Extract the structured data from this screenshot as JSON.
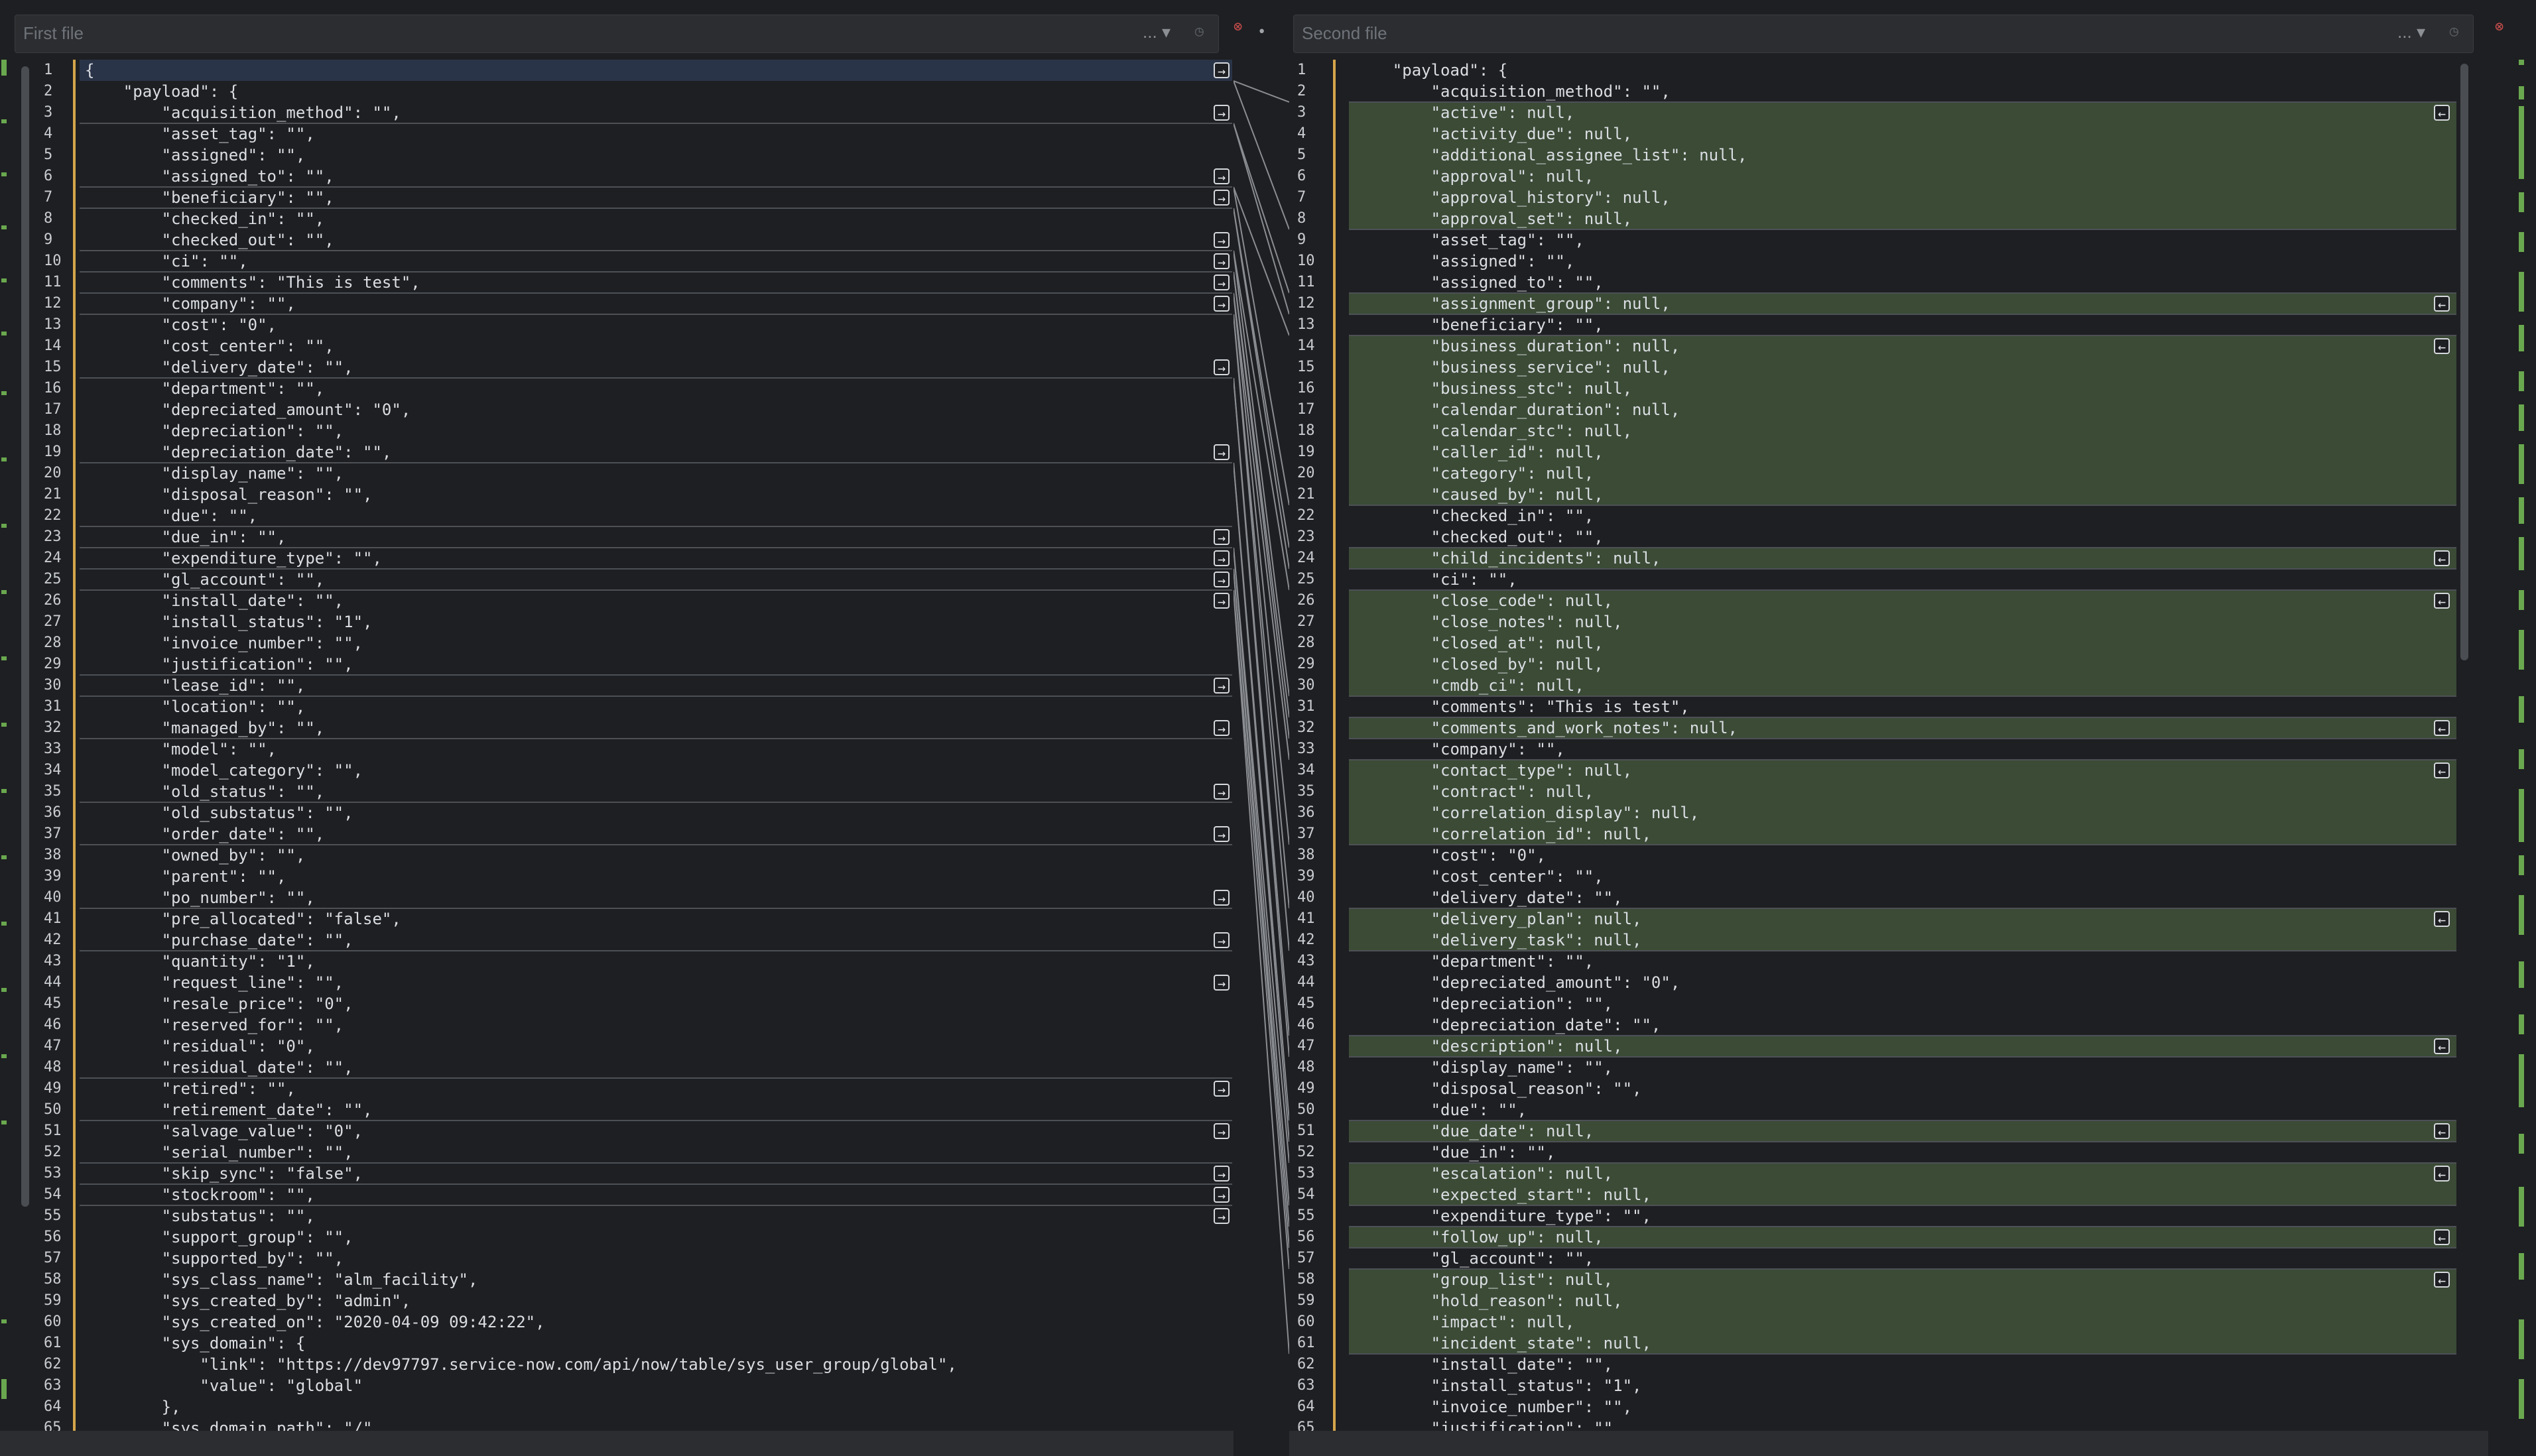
{
  "left": {
    "title": "First file",
    "menu": "...",
    "lines": [
      "{",
      "    \"payload\": {",
      "        \"acquisition_method\": \"\",",
      "        \"asset_tag\": \"\",",
      "        \"assigned\": \"\",",
      "        \"assigned_to\": \"\",",
      "        \"beneficiary\": \"\",",
      "        \"checked_in\": \"\",",
      "        \"checked_out\": \"\",",
      "        \"ci\": \"\",",
      "        \"comments\": \"This is test\",",
      "        \"company\": \"\",",
      "        \"cost\": \"0\",",
      "        \"cost_center\": \"\",",
      "        \"delivery_date\": \"\",",
      "        \"department\": \"\",",
      "        \"depreciated_amount\": \"0\",",
      "        \"depreciation\": \"\",",
      "        \"depreciation_date\": \"\",",
      "        \"display_name\": \"\",",
      "        \"disposal_reason\": \"\",",
      "        \"due\": \"\",",
      "        \"due_in\": \"\",",
      "        \"expenditure_type\": \"\",",
      "        \"gl_account\": \"\",",
      "        \"install_date\": \"\",",
      "        \"install_status\": \"1\",",
      "        \"invoice_number\": \"\",",
      "        \"justification\": \"\",",
      "        \"lease_id\": \"\",",
      "        \"location\": \"\",",
      "        \"managed_by\": \"\",",
      "        \"model\": \"\",",
      "        \"model_category\": \"\",",
      "        \"old_status\": \"\",",
      "        \"old_substatus\": \"\",",
      "        \"order_date\": \"\",",
      "        \"owned_by\": \"\",",
      "        \"parent\": \"\",",
      "        \"po_number\": \"\",",
      "        \"pre_allocated\": \"false\",",
      "        \"purchase_date\": \"\",",
      "        \"quantity\": \"1\",",
      "        \"request_line\": \"\",",
      "        \"resale_price\": \"0\",",
      "        \"reserved_for\": \"\",",
      "        \"residual\": \"0\",",
      "        \"residual_date\": \"\",",
      "        \"retired\": \"\",",
      "        \"retirement_date\": \"\",",
      "        \"salvage_value\": \"0\",",
      "        \"serial_number\": \"\",",
      "        \"skip_sync\": \"false\",",
      "        \"stockroom\": \"\",",
      "        \"substatus\": \"\",",
      "        \"support_group\": \"\",",
      "        \"supported_by\": \"\",",
      "        \"sys_class_name\": \"alm_facility\",",
      "        \"sys_created_by\": \"admin\",",
      "        \"sys_created_on\": \"2020-04-09 09:42:22\",",
      "        \"sys_domain\": {",
      "            \"link\": \"https://dev97797.service-now.com/api/now/table/sys_user_group/global\",",
      "            \"value\": \"global\"",
      "        },",
      "        \"sys_domain_path\": \"/\","
    ]
  },
  "right": {
    "title": "Second file",
    "menu": "...",
    "lines": [
      "    \"payload\": {",
      "        \"acquisition_method\": \"\",",
      "        \"active\": null,",
      "        \"activity_due\": null,",
      "        \"additional_assignee_list\": null,",
      "        \"approval\": null,",
      "        \"approval_history\": null,",
      "        \"approval_set\": null,",
      "        \"asset_tag\": \"\",",
      "        \"assigned\": \"\",",
      "        \"assigned_to\": \"\",",
      "        \"assignment_group\": null,",
      "        \"beneficiary\": \"\",",
      "        \"business_duration\": null,",
      "        \"business_service\": null,",
      "        \"business_stc\": null,",
      "        \"calendar_duration\": null,",
      "        \"calendar_stc\": null,",
      "        \"caller_id\": null,",
      "        \"category\": null,",
      "        \"caused_by\": null,",
      "        \"checked_in\": \"\",",
      "        \"checked_out\": \"\",",
      "        \"child_incidents\": null,",
      "        \"ci\": \"\",",
      "        \"close_code\": null,",
      "        \"close_notes\": null,",
      "        \"closed_at\": null,",
      "        \"closed_by\": null,",
      "        \"cmdb_ci\": null,",
      "        \"comments\": \"This is test\",",
      "        \"comments_and_work_notes\": null,",
      "        \"company\": \"\",",
      "        \"contact_type\": null,",
      "        \"contract\": null,",
      "        \"correlation_display\": null,",
      "        \"correlation_id\": null,",
      "        \"cost\": \"0\",",
      "        \"cost_center\": \"\",",
      "        \"delivery_date\": \"\",",
      "        \"delivery_plan\": null,",
      "        \"delivery_task\": null,",
      "        \"department\": \"\",",
      "        \"depreciated_amount\": \"0\",",
      "        \"depreciation\": \"\",",
      "        \"depreciation_date\": \"\",",
      "        \"description\": null,",
      "        \"display_name\": \"\",",
      "        \"disposal_reason\": \"\",",
      "        \"due\": \"\",",
      "        \"due_date\": null,",
      "        \"due_in\": \"\",",
      "        \"escalation\": null,",
      "        \"expected_start\": null,",
      "        \"expenditure_type\": \"\",",
      "        \"follow_up\": null,",
      "        \"gl_account\": \"\",",
      "        \"group_list\": null,",
      "        \"hold_reason\": null,",
      "        \"impact\": null,",
      "        \"incident_state\": null,",
      "        \"install_date\": \"\",",
      "        \"install_status\": \"1\",",
      "        \"invoice_number\": \"\",",
      "        \"justification\": \"\","
    ]
  }
}
